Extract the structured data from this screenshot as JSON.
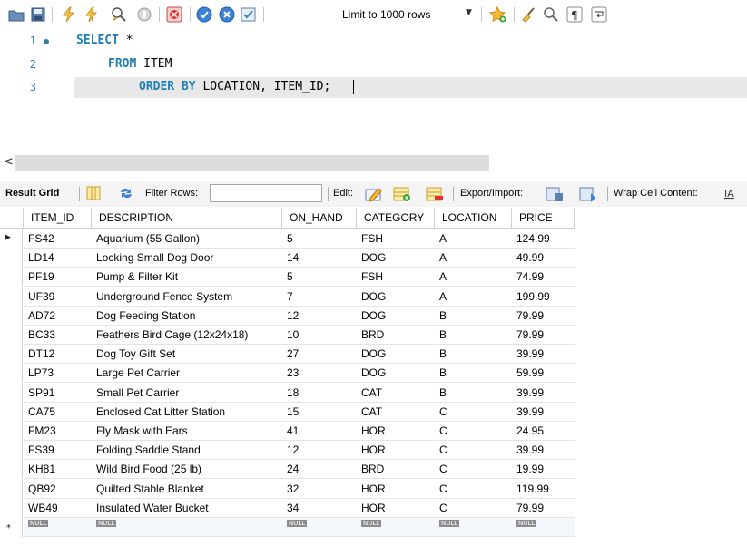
{
  "toolbar": {
    "icons": [
      "open-folder-icon",
      "save-icon",
      "execute-icon",
      "execute-current-icon",
      "explain-icon",
      "stop-icon",
      "toggle-error-icon",
      "commit-icon",
      "rollback-icon",
      "autocommit-icon",
      "add-snippet-icon",
      "beautify-icon",
      "find-icon",
      "invisible-chars-icon",
      "wrap-icon"
    ],
    "limit_label": "Limit to 1000 rows"
  },
  "editor": {
    "line_numbers": [
      "1",
      "2",
      "3"
    ],
    "lines": [
      {
        "kw": "SELECT",
        "rest": " *"
      },
      {
        "kw": "FROM",
        "rest": " ITEM"
      },
      {
        "kw": "ORDER BY",
        "rest": " LOCATION, ITEM_ID;"
      }
    ]
  },
  "result_toolbar": {
    "result_grid": "Result Grid",
    "filter_rows": "Filter Rows:",
    "filter_value": "",
    "edit": "Edit:",
    "export_import": "Export/Import:",
    "wrap": "Wrap Cell Content:"
  },
  "grid": {
    "columns": [
      "ITEM_ID",
      "DESCRIPTION",
      "ON_HAND",
      "CATEGORY",
      "LOCATION",
      "PRICE"
    ],
    "rows": [
      [
        "FS42",
        "Aquarium (55 Gallon)",
        "5",
        "FSH",
        "A",
        "124.99"
      ],
      [
        "LD14",
        "Locking Small Dog Door",
        "14",
        "DOG",
        "A",
        "49.99"
      ],
      [
        "PF19",
        "Pump & Filter Kit",
        "5",
        "FSH",
        "A",
        "74.99"
      ],
      [
        "UF39",
        "Underground Fence System",
        "7",
        "DOG",
        "A",
        "199.99"
      ],
      [
        "AD72",
        "Dog Feeding Station",
        "12",
        "DOG",
        "B",
        "79.99"
      ],
      [
        "BC33",
        "Feathers Bird Cage (12x24x18)",
        "10",
        "BRD",
        "B",
        "79.99"
      ],
      [
        "DT12",
        "Dog Toy Gift Set",
        "27",
        "DOG",
        "B",
        "39.99"
      ],
      [
        "LP73",
        "Large Pet Carrier",
        "23",
        "DOG",
        "B",
        "59.99"
      ],
      [
        "SP91",
        "Small Pet Carrier",
        "18",
        "CAT",
        "B",
        "39.99"
      ],
      [
        "CA75",
        "Enclosed Cat Litter Station",
        "15",
        "CAT",
        "C",
        "39.99"
      ],
      [
        "FM23",
        "Fly Mask with Ears",
        "41",
        "HOR",
        "C",
        "24.95"
      ],
      [
        "FS39",
        "Folding Saddle Stand",
        "12",
        "HOR",
        "C",
        "39.99"
      ],
      [
        "KH81",
        "Wild Bird Food (25 lb)",
        "24",
        "BRD",
        "C",
        "19.99"
      ],
      [
        "QB92",
        "Quilted Stable Blanket",
        "32",
        "HOR",
        "C",
        "119.99"
      ],
      [
        "WB49",
        "Insulated Water Bucket",
        "34",
        "HOR",
        "C",
        "79.99"
      ]
    ],
    "null_label": "NULL",
    "current_row_marker": "▶",
    "new_row_marker": "*"
  }
}
